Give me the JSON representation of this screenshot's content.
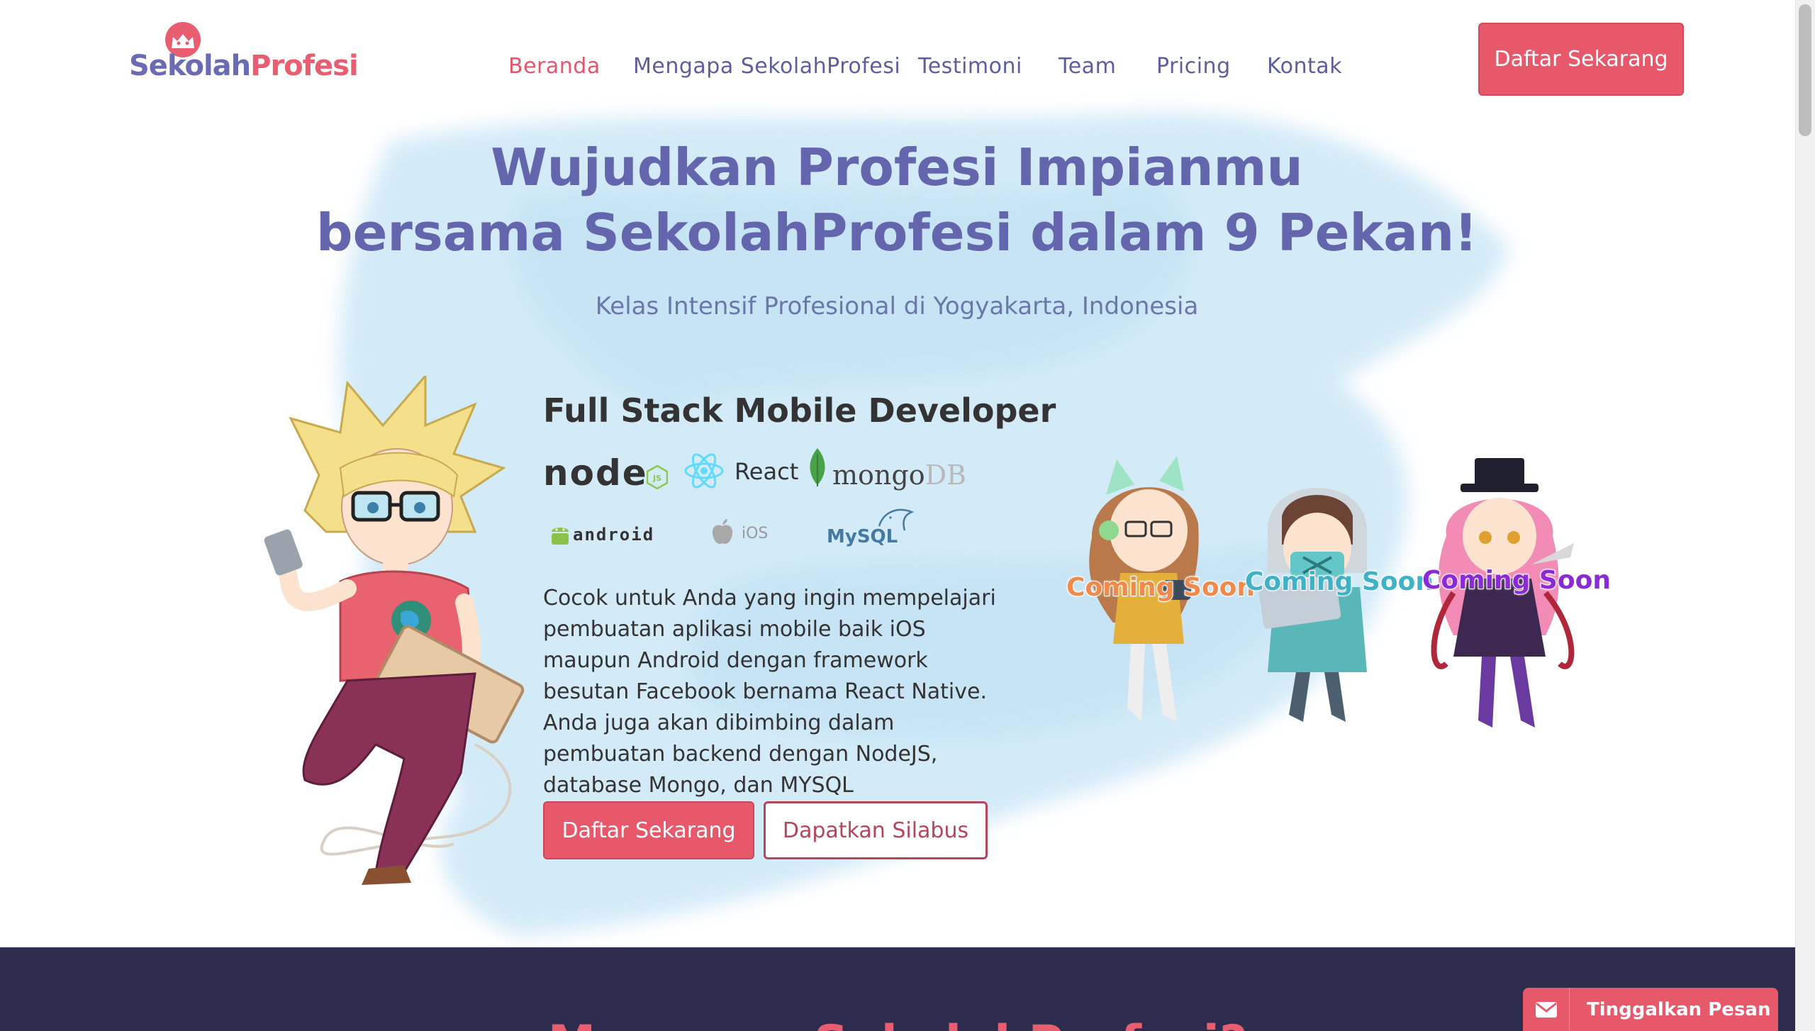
{
  "brand": {
    "part1": "Sekolah",
    "part2": "Profesi"
  },
  "nav": {
    "items": [
      {
        "label": "Beranda",
        "active": true
      },
      {
        "label": "Mengapa SekolahProfesi"
      },
      {
        "label": "Testimoni"
      },
      {
        "label": "Team"
      },
      {
        "label": "Pricing"
      },
      {
        "label": "Kontak"
      }
    ],
    "cta_label": "Daftar Sekarang"
  },
  "hero": {
    "title_line1": "Wujudkan Profesi Impianmu",
    "title_line2": "bersama SekolahProfesi dalam 9 Pekan!",
    "subtitle": "Kelas Intensif Profesional di Yogyakarta, Indonesia"
  },
  "course": {
    "title": "Full Stack Mobile Developer",
    "tech": {
      "node": "node",
      "node_badge": "JS",
      "react": "React",
      "mongo": "mongo",
      "mongo_db": "DB",
      "android": "android",
      "ios": "iOS",
      "mysql": "MySQL"
    },
    "description": "Cocok untuk Anda yang ingin mempelajari pembuatan aplikasi mobile baik iOS maupun Android dengan framework besutan Facebook bernama React Native. Anda juga akan dibimbing dalam pembuatan backend dengan NodeJS, database Mongo, dan MYSQL",
    "primary_button": "Daftar Sekarang",
    "secondary_button": "Dapatkan Silabus"
  },
  "upcoming": [
    {
      "label": "Coming Soon",
      "color": "#f08a4b"
    },
    {
      "label": "Coming Soon",
      "color": "#3fb2c7"
    },
    {
      "label": "Coming Soon",
      "color": "#8c2bd6"
    }
  ],
  "next_section": {
    "title": "Mengapa SekolahProfesi?"
  },
  "message_tab": {
    "label": "Tinggalkan Pesan",
    "icon": "envelope-icon"
  },
  "colors": {
    "primary": "#e8586b",
    "brand_blue": "#6466ad",
    "dark_band": "#2d2b4e"
  }
}
